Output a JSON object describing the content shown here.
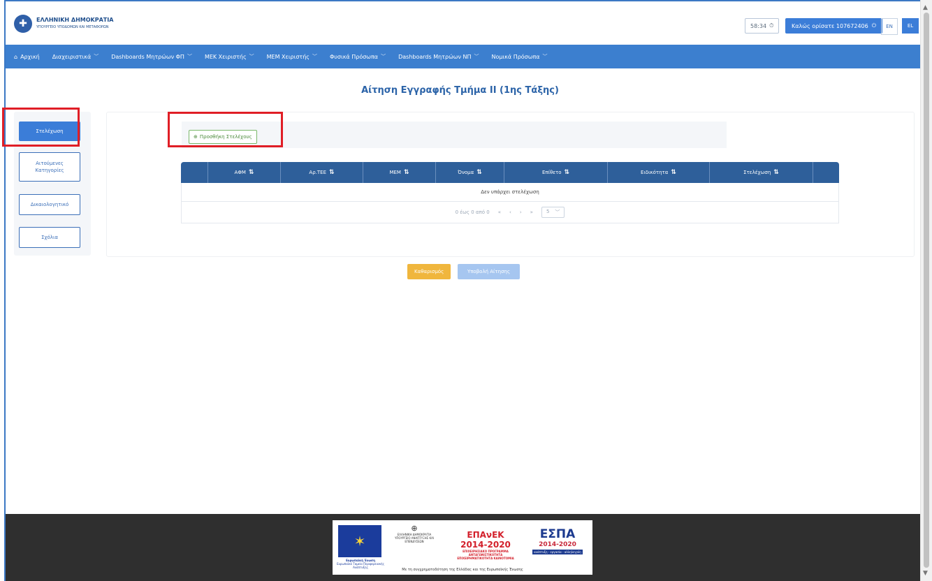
{
  "header": {
    "logo_line1": "ΕΛΛΗΝΙΚΗ ΔΗΜΟΚΡΑΤΙΑ",
    "logo_line2": "ΥΠΟΥΡΓΕΙΟ ΥΠΟΔΟΜΩΝ ΚΑΙ ΜΕΤΑΦΟΡΩΝ",
    "clock": "58:34",
    "welcome": "Καλώς ορίσατε 107672406",
    "lang_en": "EN",
    "lang_el": "EL"
  },
  "nav": {
    "items": [
      {
        "label": "Αρχική",
        "icon": "home-icon"
      },
      {
        "label": "Διαχειριστικά"
      },
      {
        "label": "Dashboards Μητρώων ΦΠ"
      },
      {
        "label": "ΜΕΚ Χειριστής"
      },
      {
        "label": "ΜΕΜ Χειριστής"
      },
      {
        "label": "Φυσικά Πρόσωπα"
      },
      {
        "label": "Dashboards Μητρώων ΝΠ"
      },
      {
        "label": "Νομικά Πρόσωπα"
      }
    ]
  },
  "page": {
    "title": "Αίτηση Εγγραφής Τμήμα ΙΙ (1ης Τάξης)"
  },
  "sidenav": {
    "staff": "Στελέχωση",
    "categories": "Αιτούμενες Κατηγορίες",
    "documents": "Δικαιολογητικό",
    "comments": "Σχόλια"
  },
  "toolbar": {
    "add_label": "Προσθήκη Στελέχους"
  },
  "table": {
    "columns": [
      "ΑΦΜ",
      "Αρ.ΤΕΕ",
      "ΜΕΜ",
      "Όνομα",
      "Επίθετο",
      "Ειδικότητα",
      "Στελέχωση"
    ],
    "empty_message": "Δεν υπάρχει στελέχωση",
    "pager_text": "0 έως 0 από 0",
    "rows_per_page": "5"
  },
  "actions": {
    "clear": "Καθαρισμός",
    "submit": "Υποβολή Αίτησης"
  },
  "footer": {
    "eu_text": "Ευρωπαϊκή Ένωση",
    "eu_fund": "Ευρωπαϊκό Ταμείο Περιφερειακής Ανάπτυξης",
    "gov_text": "ΕΛΛΗΝΙΚΗ ΔΗΜΟΚΡΑΤΙΑ ΥΠΟΥΡΓΕΙΟ ΑΝΑΠΤΥΞΗΣ ΚΑΙ ΕΠΕΝΔΥΣΕΩΝ",
    "epanek": "ΕΠΑνΕΚ 2014-2020",
    "epanek_sub": "ΕΠΙΧΕΙΡΗΣΙΑΚΟ ΠΡΟΓΡΑΜΜΑ ΑΝΤΑΓΩΝΙΣΤΙΚΟΤΗΤΑ ΕΠΙΧΕΙΡΗΜΑΤΙΚΟΤΗΤΑ ΚΑΙΝΟΤΟΜΙΑ",
    "espa": "ΕΣΠΑ",
    "espa_years": "2014-2020",
    "espa_bar": "ανάπτυξη - εργασία - αλληλεγγύη",
    "cofund": "Με τη συγχρηματοδότηση της Ελλάδας και της Ευρωπαϊκής Ένωσης"
  },
  "colors": {
    "nav_blue": "#3c7fcf",
    "table_header": "#2e5f9a",
    "highlight_red": "#e01e26",
    "clear_orange": "#f0b63d",
    "submit_disabled": "#a6c6f0"
  }
}
